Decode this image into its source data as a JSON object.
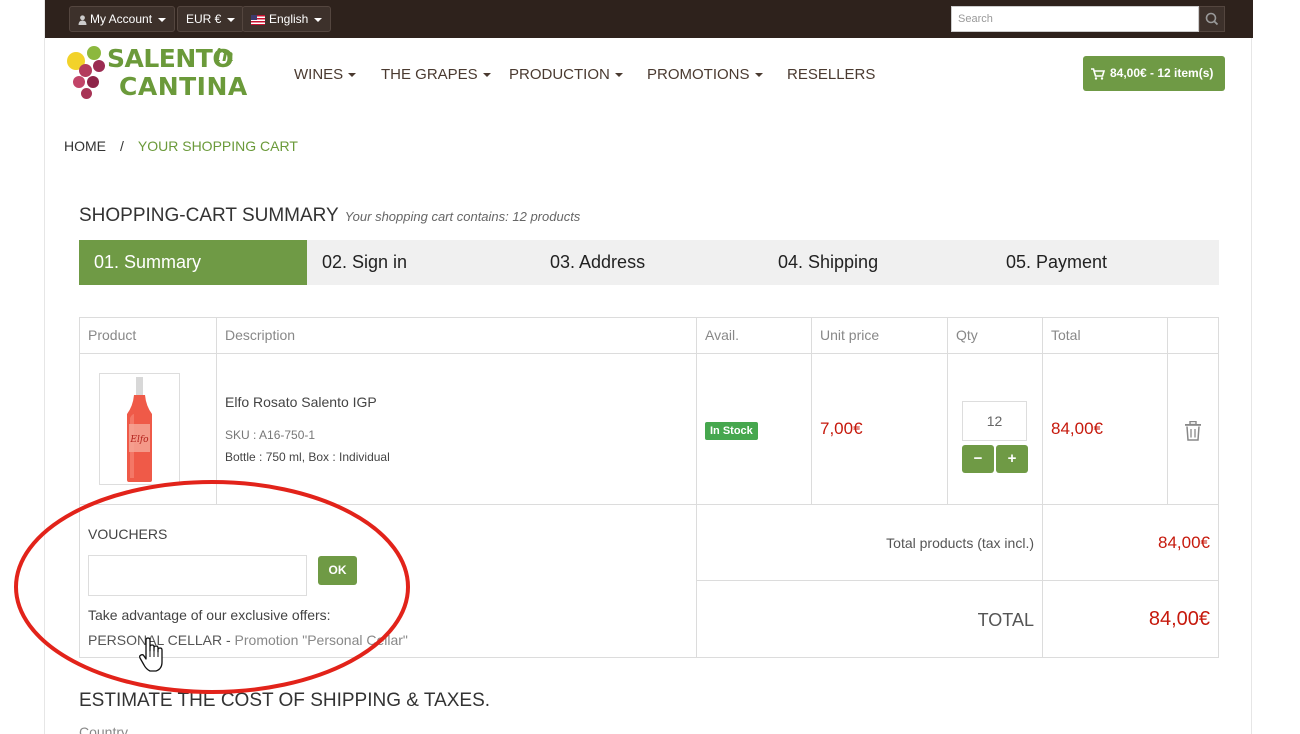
{
  "topbar": {
    "account_label": "My Account",
    "currency_label": "EUR €",
    "language_label": "English",
    "search_placeholder": "Search"
  },
  "logo": {
    "line1": "SALENTO",
    "line2": "CANTINA",
    "in": "in"
  },
  "nav": {
    "items": [
      {
        "label": "WINES"
      },
      {
        "label": "THE GRAPES"
      },
      {
        "label": "PRODUCTION"
      },
      {
        "label": "PROMOTIONS"
      },
      {
        "label": "RESELLERS"
      }
    ]
  },
  "cart_button": {
    "label": "84,00€ - 12 item(s)"
  },
  "breadcrumb": {
    "home": "HOME",
    "separator": "/",
    "current": "YOUR SHOPPING CART"
  },
  "summary": {
    "title": "SHOPPING-CART SUMMARY",
    "subtitle": "Your shopping cart contains: 12 products"
  },
  "steps": [
    {
      "label": "01. Summary",
      "active": true
    },
    {
      "label": "02. Sign in",
      "active": false
    },
    {
      "label": "03. Address",
      "active": false
    },
    {
      "label": "04. Shipping",
      "active": false
    },
    {
      "label": "05. Payment",
      "active": false
    }
  ],
  "table": {
    "headers": [
      "Product",
      "Description",
      "Avail.",
      "Unit price",
      "Qty",
      "Total"
    ],
    "row": {
      "name": "Elfo Rosato Salento IGP",
      "sku": "SKU : A16-750-1",
      "attributes": "Bottle : 750 ml, Box : Individual",
      "availability": "In Stock",
      "unit_price": "7,00€",
      "qty": "12",
      "minus": "−",
      "plus": "+",
      "total": "84,00€"
    }
  },
  "vouchers": {
    "label": "VOUCHERS",
    "ok": "OK",
    "offers_label": "Take advantage of our exclusive offers:",
    "offer_code": "PERSONAL CELLAR",
    "offer_sep": " - ",
    "offer_desc": "Promotion \"Personal Cellar\""
  },
  "totals": {
    "products_label": "Total products (tax incl.)",
    "products_value": "84,00€",
    "total_label": "TOTAL",
    "total_value": "84,00€"
  },
  "estimate": {
    "title": "ESTIMATE THE COST OF SHIPPING & TAXES.",
    "country_label": "Country"
  },
  "colors": {
    "topbar": "#2e221c",
    "accent_green": "#6f9a45",
    "price_red": "#c6190c",
    "instock_green": "#46a74e",
    "annotation_red": "#e2231a"
  }
}
